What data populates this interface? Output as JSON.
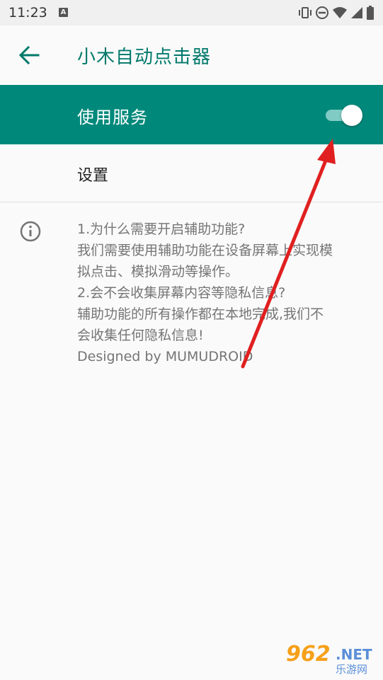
{
  "status_bar": {
    "time": "11:23",
    "notification_icon": "A",
    "icons": [
      "vibrate-icon",
      "dnd-icon",
      "wifi-icon",
      "signal-icon",
      "battery-icon"
    ]
  },
  "app_bar": {
    "back_icon": "arrow-left-icon",
    "title": "小木自动点击器"
  },
  "service": {
    "label": "使用服务",
    "enabled": true
  },
  "settings": {
    "label": "设置"
  },
  "info": {
    "icon": "info-icon",
    "lines": [
      "1.为什么需要开启辅助功能?",
      "我们需要使用辅助功能在设备屏幕上实现模",
      "拟点击、模拟滑动等操作。",
      "2.会不会收集屏幕内容等隐私信息?",
      "辅助功能的所有操作都在本地完成,我们不",
      "会收集任何隐私信息!"
    ],
    "credit": "Designed by MUMUDROID"
  },
  "watermark": {
    "number": "962",
    "domain": ".NET",
    "site_name": "乐游网"
  },
  "colors": {
    "primary": "#00897b",
    "primary_dark_text": "#00796b",
    "toggle_track": "#80cbc4",
    "annotation_arrow": "#e02020"
  }
}
